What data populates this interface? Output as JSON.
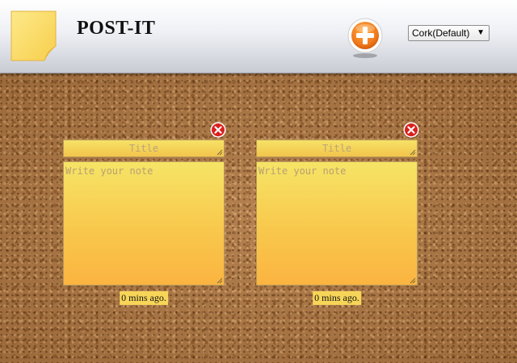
{
  "header": {
    "title": "POST-IT",
    "add_button": {
      "icon": "plus-circle-icon"
    },
    "theme_select": {
      "selected": "Cork(Default)"
    }
  },
  "notes": [
    {
      "title_placeholder": "Title",
      "body_placeholder": "Write your note",
      "timestamp": "0 mins ago."
    },
    {
      "title_placeholder": "Title",
      "body_placeholder": "Write your note",
      "timestamp": "0 mins ago."
    }
  ],
  "colors": {
    "note_top": "#f6e466",
    "note_bottom": "#fbb441",
    "close_red": "#d9201c",
    "add_orange": "#f28c1e",
    "cork": "#b07a46"
  }
}
